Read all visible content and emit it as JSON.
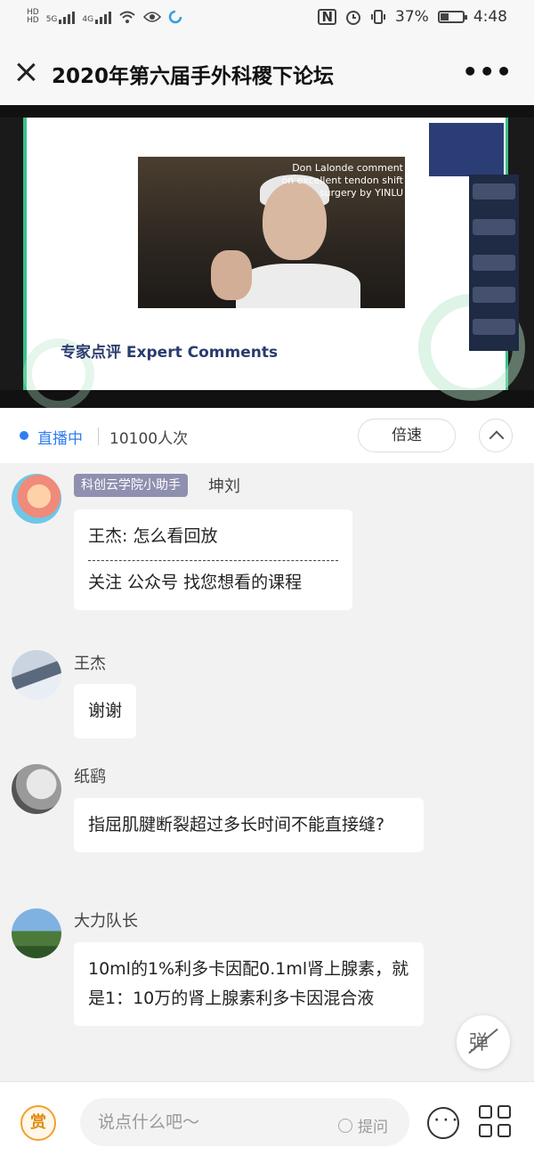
{
  "status_bar": {
    "left_icons": [
      "hd-icon",
      "5g-signal-icon",
      "4g-signal-icon",
      "wifi-icon",
      "eye-icon",
      "loading-icon"
    ],
    "net_5g": "5G",
    "net_4g": "4G",
    "battery": "37%",
    "time": "4:48"
  },
  "header": {
    "title": "2020年第六届手外科稷下论坛",
    "more_label": "•••"
  },
  "video": {
    "overlay_text": "Don Lalonde comment on excellent tendon shift surgery by YINLU",
    "slide_caption": "专家点评 Expert Comments"
  },
  "live_bar": {
    "status": "直播中",
    "viewers": "10100人次",
    "speed_label": "倍速"
  },
  "messages": [
    {
      "badge": "科创云学院小助手",
      "name": "坤刘",
      "lines": [
        "王杰: 怎么看回放",
        "关注 公众号 找您想看的课程"
      ]
    },
    {
      "name": "王杰",
      "text": "谢谢"
    },
    {
      "name": "纸鹞",
      "text": "指屈肌腱断裂超过多长时间不能直接缝?"
    },
    {
      "name": "大力队长",
      "text": "10ml的1%利多卡因配0.1ml肾上腺素，就是1：10万的肾上腺素利多卡因混合液"
    }
  ],
  "danmu_label": "弹",
  "bottom_bar": {
    "reward_label": "赏",
    "input_placeholder": "说点什么吧～",
    "ask_label": "提问"
  },
  "colors": {
    "accent_blue": "#2f7df0",
    "badge_bg": "#8f8fb0",
    "slide_green": "#3cc08a",
    "reward_orange": "#f0a030"
  }
}
